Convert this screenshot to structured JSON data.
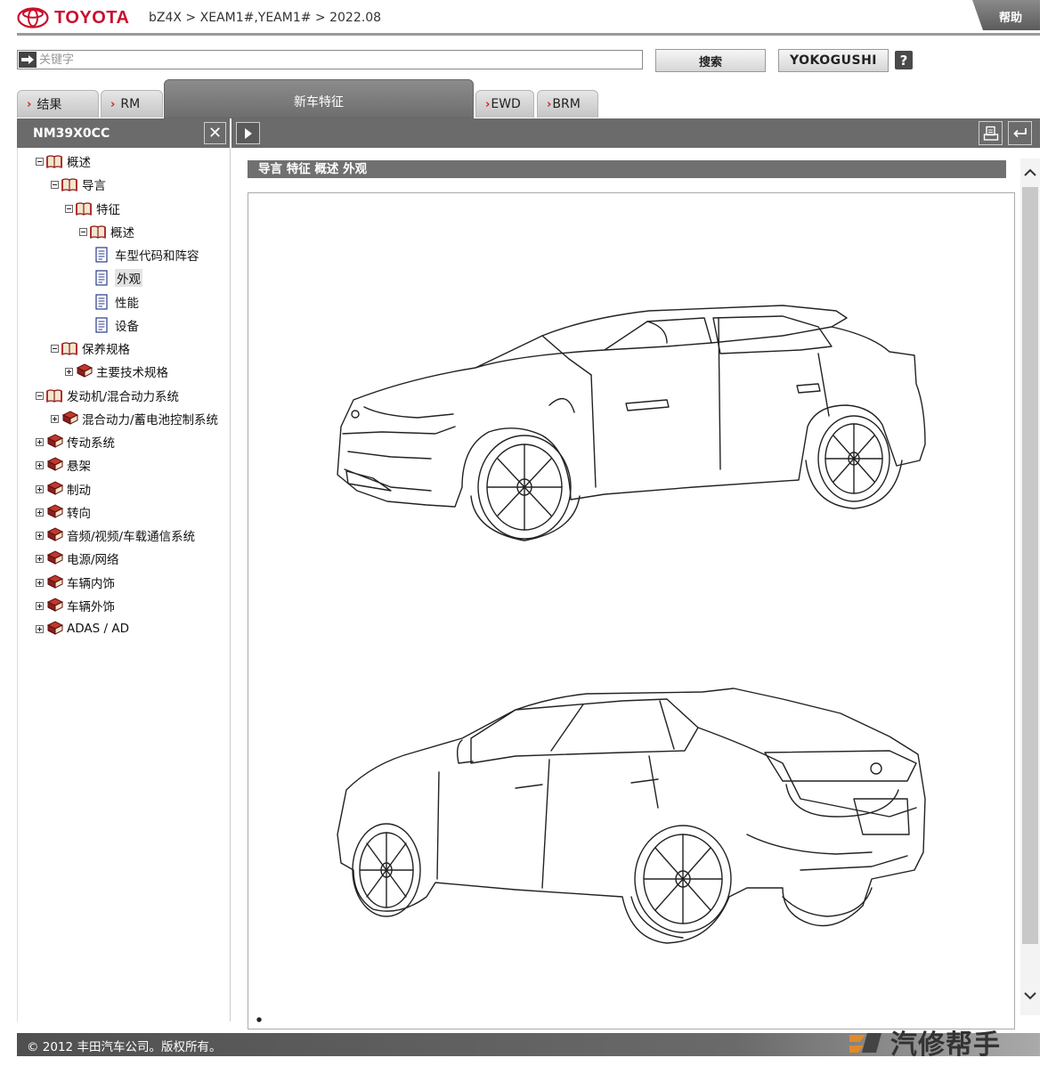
{
  "header": {
    "brand": "TOYOTA",
    "breadcrumb": "bZ4X > XEAM1#,YEAM1# > 2022.08",
    "help_label": "帮助"
  },
  "search": {
    "placeholder": "关键字",
    "search_label": "搜索",
    "yokogushi_label": "YOKOGUSHI",
    "help_label": "?"
  },
  "tabs": [
    {
      "label": "结果"
    },
    {
      "label": "RM"
    },
    {
      "label": "新车特征"
    },
    {
      "label": "EWD"
    },
    {
      "label": "BRM"
    }
  ],
  "toolbar": {
    "doc_code": "NM39X0CC",
    "close_glyph": "✕"
  },
  "tree": [
    {
      "label": "概述"
    },
    {
      "label": "导言"
    },
    {
      "label": "特征"
    },
    {
      "label": "概述"
    },
    {
      "label": "车型代码和阵容"
    },
    {
      "label": "外观"
    },
    {
      "label": "性能"
    },
    {
      "label": "设备"
    },
    {
      "label": "保养规格"
    },
    {
      "label": "主要技术规格"
    },
    {
      "label": "发动机/混合动力系统"
    },
    {
      "label": "混合动力/蓄电池控制系统"
    },
    {
      "label": "传动系统"
    },
    {
      "label": "悬架"
    },
    {
      "label": "制动"
    },
    {
      "label": "转向"
    },
    {
      "label": "音频/视频/车载通信系统"
    },
    {
      "label": "电源/网络"
    },
    {
      "label": "车辆内饰"
    },
    {
      "label": "车辆外饰"
    },
    {
      "label": "ADAS / AD"
    }
  ],
  "content": {
    "path_title": "导言  特征  概述  外观"
  },
  "footer": {
    "copyright": "© 2012 丰田汽车公司。版权所有。",
    "watermark": "汽修帮手"
  },
  "colors": {
    "brand_red": "#c8102e",
    "toolbar_gray": "#6b6b6b"
  }
}
